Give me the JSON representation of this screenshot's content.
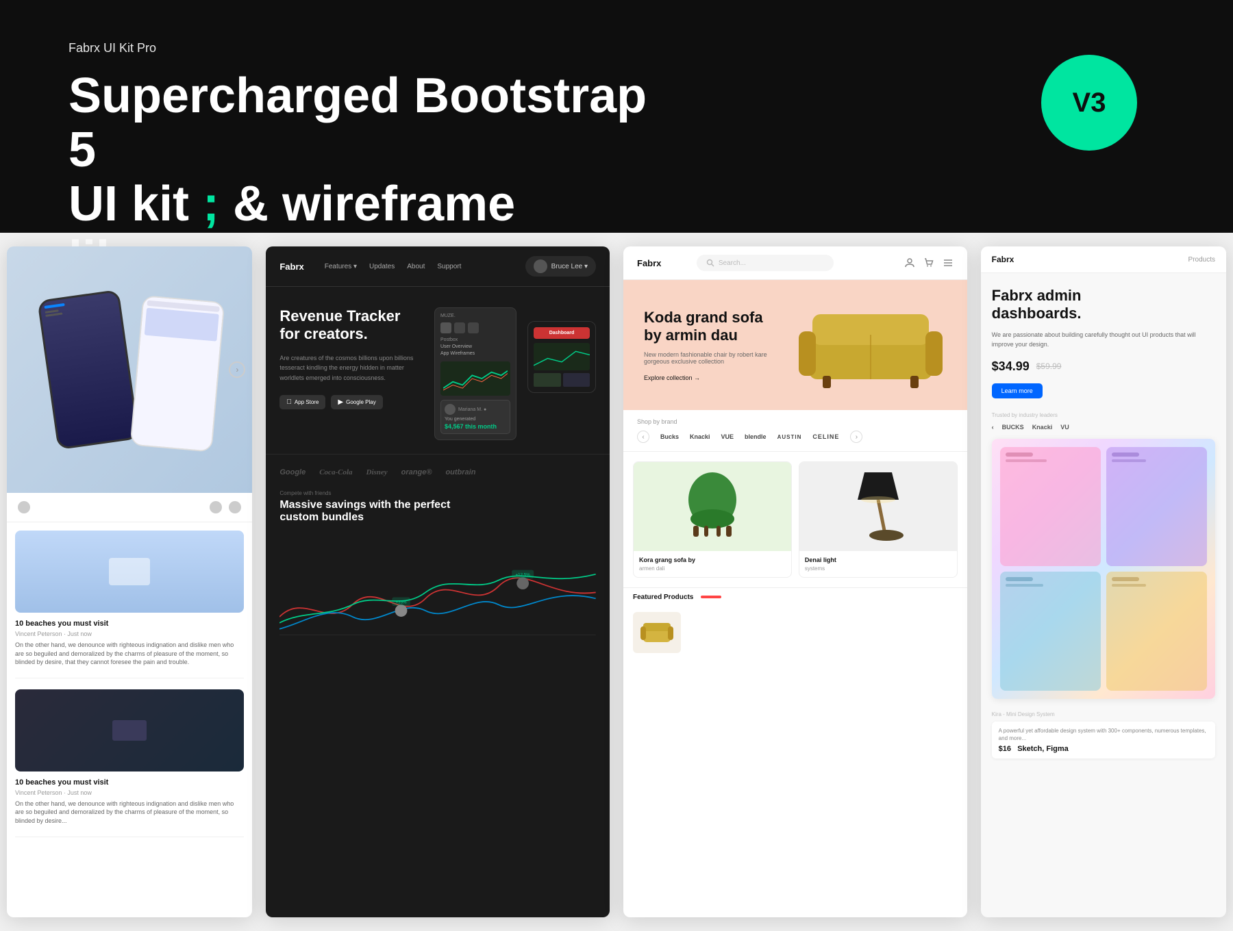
{
  "hero": {
    "subtitle": "Fabrx UI Kit Pro",
    "title_line1": "Supercharged Bootstrap 5",
    "title_line2": "UI kit ",
    "title_accent": ";",
    "title_line3": " & wireframe library.",
    "badge": "V3",
    "accent_color": "#00e5a0"
  },
  "cards": [
    {
      "id": "card-blog",
      "articles": [
        {
          "title": "10 beaches you must visit",
          "meta": "Vincent Peterson · Just now",
          "excerpt": "On the other hand, we denounce with righteous indignation and dislike men who are so beguiled and demoralized by the charms of pleasure of the moment, so blinded by desire..."
        },
        {
          "title": "10 beaches you must visit",
          "meta": "Vincent Peterson · Just now",
          "excerpt": "On the other hand, we denounce with righteous indignation and dislike men who are so beguiled and demoralized by the charms of pleasure of the moment, so blinded by desire..."
        }
      ]
    },
    {
      "id": "card-revenue",
      "logo": "Fabrx",
      "nav_links": [
        "Features ▾",
        "Updates",
        "About",
        "Support"
      ],
      "user": "Bruce Lee ▾",
      "hero_title": "Revenue Tracker\nfor creators.",
      "hero_desc": "Are creatures of the cosmos billions upon billions tesseract kindling the energy hidden in matter worldlets emerged into consciousness.",
      "btn_appstore": "App Store",
      "btn_playstore": "Google Play",
      "brands": [
        "Google",
        "Coca-Cola",
        "Disney",
        "orange®",
        "outbrain"
      ],
      "section_tag": "Compete with friends",
      "section_heading": "Massive savings with the perfect\ncustom bundles",
      "notification_text": "You generated",
      "notification_amount": "$4,567 this month",
      "annotation1": "+33%",
      "annotation2": "+12.5%"
    },
    {
      "id": "card-ecommerce",
      "logo": "Fabrx",
      "search_placeholder": "Search...",
      "hero_title": "Koda grand sofa\nby armin dau",
      "hero_subtitle": "New modern fashionable chair by robert kare gorgeous exclusive collection",
      "explore_btn": "Explore collection →",
      "brands_label": "Shop by brand",
      "brands": [
        "Bucks",
        "Knacki",
        "VUE",
        "blendle",
        "AUSTIN",
        "CELINE"
      ],
      "products": [
        {
          "name": "Kora grang sofa by",
          "subname": "armen dali"
        },
        {
          "name": "Denai light",
          "subname": "systems"
        }
      ],
      "featured_label": "Featured Products"
    },
    {
      "id": "card-admin",
      "logo": "Fabrx",
      "nav_label": "Products",
      "hero_title": "Fabrx admin\ndashboards.",
      "hero_desc": "We are passionate about building carefully thought out UI products that will improve your design.",
      "price_new": "$34.99",
      "price_old": "$59.99",
      "learn_more": "Learn more",
      "trusted_label": "Trusted by industry leaders",
      "trusted_brands": [
        "< BUCKS",
        "Knacki",
        "VU"
      ],
      "mini_card_label": "Kira - Mini Design System",
      "mini_card_desc": "A powerful yet affordable design system with 300+ components, numerous templates, and more...",
      "mini_card_price": "$16  Sketch, Figma"
    }
  ]
}
